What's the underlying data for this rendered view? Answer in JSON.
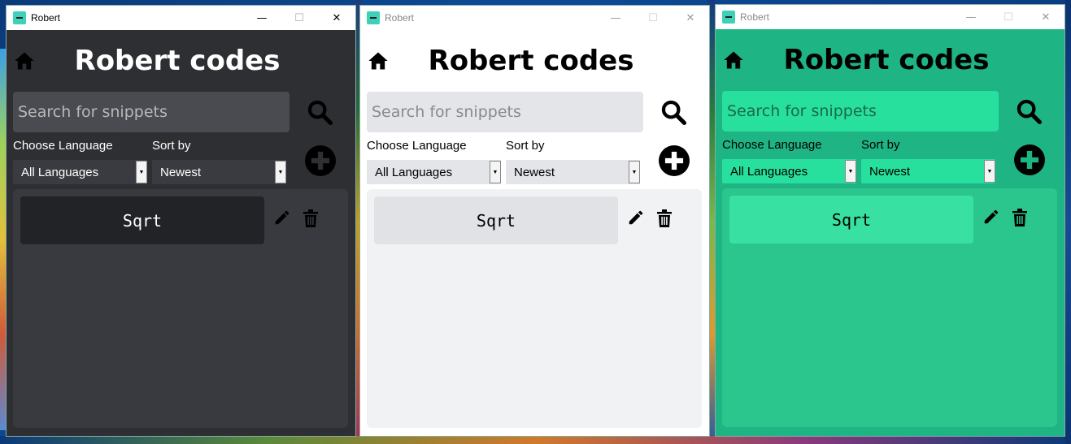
{
  "windows": [
    {
      "theme": "dark",
      "window_title": "Robert",
      "app_title": "Robert codes",
      "search_placeholder": "Search for snippets",
      "language_label": "Choose Language",
      "language_selected": "All Languages",
      "sort_label": "Sort by",
      "sort_selected": "Newest",
      "snippets": [
        {
          "title": "Sqrt"
        }
      ]
    },
    {
      "theme": "light",
      "window_title": "Robert",
      "app_title": "Robert codes",
      "search_placeholder": "Search for snippets",
      "language_label": "Choose Language",
      "language_selected": "All Languages",
      "sort_label": "Sort by",
      "sort_selected": "Newest",
      "snippets": [
        {
          "title": "Sqrt"
        }
      ]
    },
    {
      "theme": "green",
      "window_title": "Robert",
      "app_title": "Robert codes",
      "search_placeholder": "Search for snippets",
      "language_label": "Choose Language",
      "language_selected": "All Languages",
      "sort_label": "Sort by",
      "sort_selected": "Newest",
      "snippets": [
        {
          "title": "Sqrt"
        }
      ]
    }
  ],
  "window_controls": {
    "minimize": "—",
    "maximize": "☐",
    "close": "✕"
  },
  "colors": {
    "dark_bg": "#2e2f33",
    "light_bg": "#ffffff",
    "green_bg": "#1fb483",
    "app_icon": "#3fd0b8"
  },
  "icons": {
    "home": "home-icon",
    "search": "search-icon",
    "add": "plus-circle-icon",
    "edit": "pencil-icon",
    "delete": "trash-icon",
    "dropdown": "dropdown-arrow-icon"
  }
}
